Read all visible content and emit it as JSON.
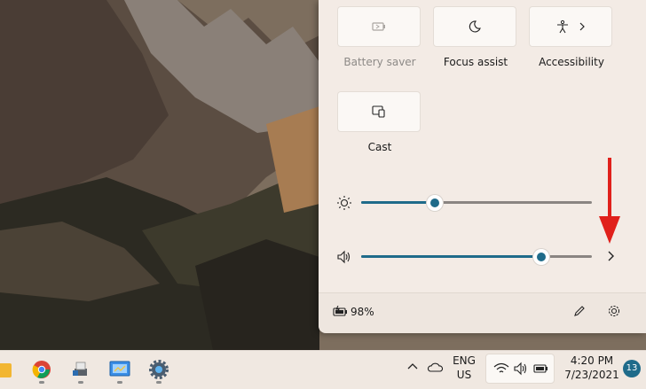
{
  "quick_settings": {
    "tiles": [
      {
        "label": "Battery saver",
        "icon": "battery-saver-icon",
        "enabled": false
      },
      {
        "label": "Focus assist",
        "icon": "moon-icon",
        "enabled": true
      },
      {
        "label": "Accessibility",
        "icon": "accessibility-icon",
        "enabled": true
      },
      {
        "label": "Cast",
        "icon": "cast-icon",
        "enabled": true
      }
    ],
    "brightness": {
      "icon": "brightness-icon",
      "level": 0.32
    },
    "volume": {
      "icon": "speaker-icon",
      "level": 0.78
    },
    "battery": {
      "percent": "98%",
      "icon": "battery-charging-icon"
    },
    "accent_color": "#1f6b8a",
    "annotation_arrow_color": "#e0201b"
  },
  "taskbar": {
    "apps": [
      "file-explorer-icon",
      "chrome-icon",
      "printer-app-icon",
      "control-panel-icon",
      "settings-icon"
    ],
    "language": {
      "line1": "ENG",
      "line2": "US"
    },
    "time": "4:20 PM",
    "date": "7/23/2021",
    "notification_count": "13"
  }
}
